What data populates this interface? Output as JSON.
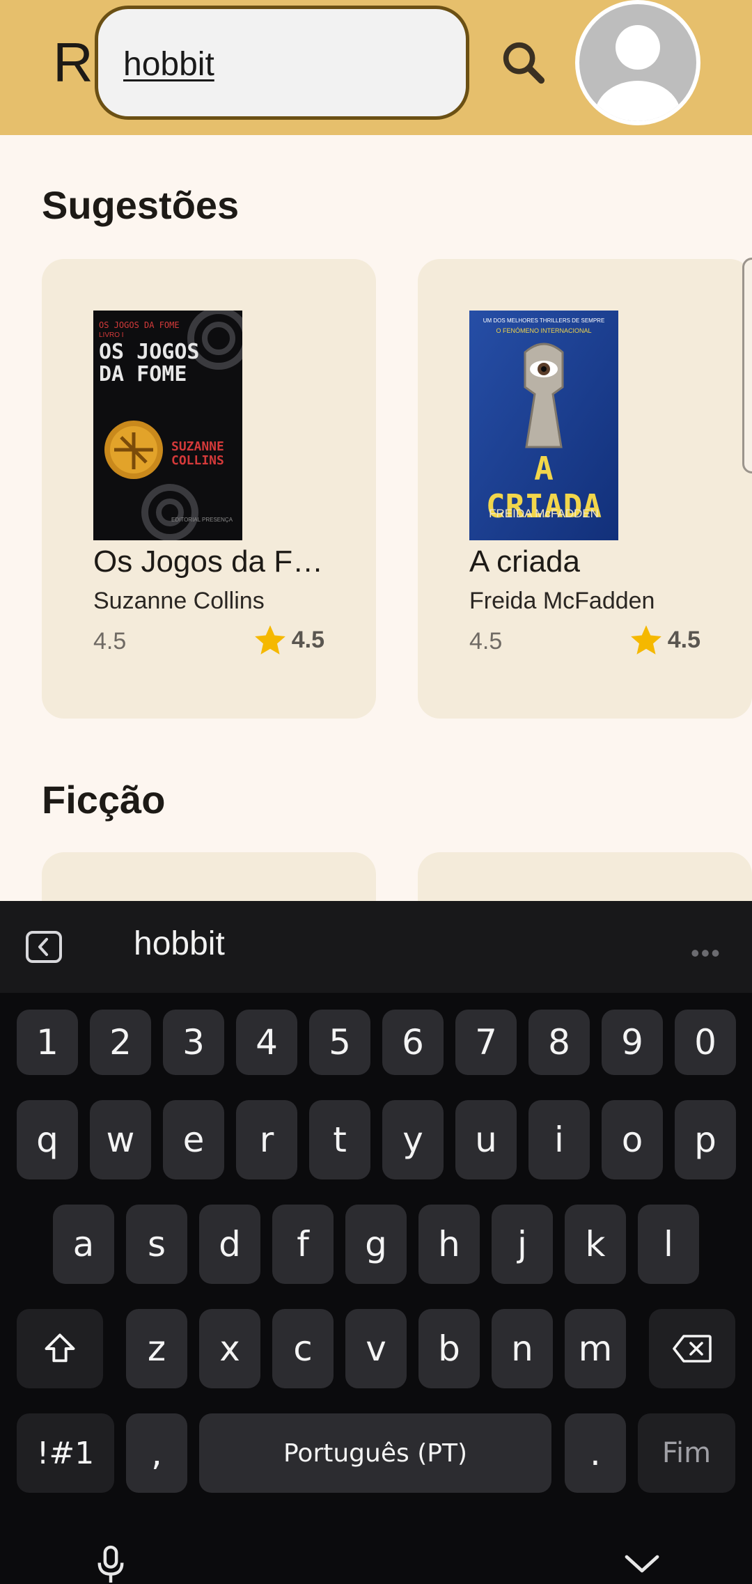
{
  "app": {
    "title": "Re"
  },
  "search": {
    "query": "hobbit"
  },
  "sections": [
    {
      "title": "Sugestões",
      "books": [
        {
          "title": "Os Jogos da Fome",
          "author": "Suzanne Collins",
          "rating": "4.5",
          "rating_star": "4.5",
          "cover": {
            "top_text": "OS JOGOS DA FOME",
            "series": "LIVRO I",
            "heading": "OS JOGOS DA FOME",
            "author": "SUZANNE COLLINS",
            "publisher": "EDITORIAL PRESENÇA"
          }
        },
        {
          "title": "A criada",
          "author": "Freida McFadden",
          "rating": "4.5",
          "rating_star": "4.5",
          "cover": {
            "top_text": "UM DOS MELHORES THRILLERS DE SEMPRE",
            "subtitle": "O FENÓMENO INTERNACIONAL",
            "heading": "A CRIADA",
            "author": "FREIDA McFADDEN"
          }
        }
      ]
    },
    {
      "title": "Ficção"
    }
  ],
  "keyboard": {
    "suggestion": "hobbit",
    "row_numbers": [
      "1",
      "2",
      "3",
      "4",
      "5",
      "6",
      "7",
      "8",
      "9",
      "0"
    ],
    "row1": [
      "q",
      "w",
      "e",
      "r",
      "t",
      "y",
      "u",
      "i",
      "o",
      "p"
    ],
    "row2": [
      "a",
      "s",
      "d",
      "f",
      "g",
      "h",
      "j",
      "k",
      "l"
    ],
    "row3": [
      "z",
      "x",
      "c",
      "v",
      "b",
      "n",
      "m"
    ],
    "symbols": "!#1",
    "comma": ",",
    "space": "Português (PT)",
    "period": ".",
    "enter": "Fim"
  },
  "colors": {
    "appbar": "#e6bf6c",
    "background": "#fdf6f0",
    "card": "#f4ebda",
    "star": "#f5b800"
  }
}
